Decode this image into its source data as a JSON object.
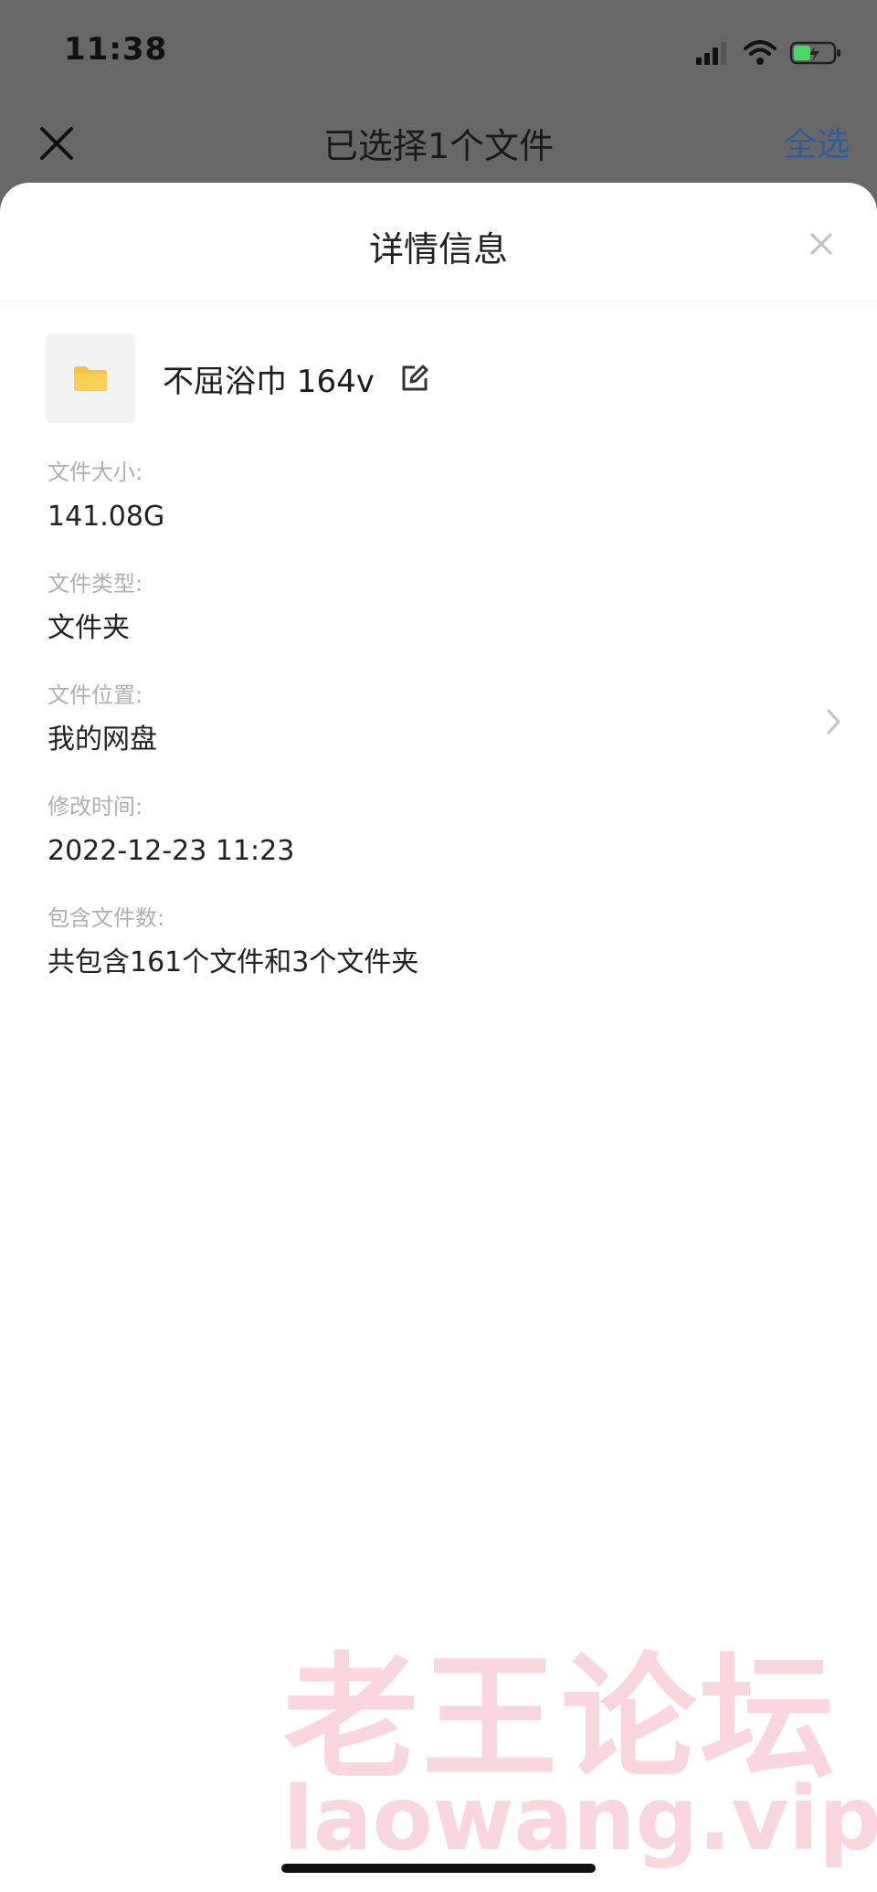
{
  "status_bar": {
    "time": "11:38",
    "icons": [
      "signal-icon",
      "wifi-icon",
      "battery-icon"
    ]
  },
  "nav": {
    "close_icon": "close-icon",
    "title": "已选择1个文件",
    "select_all": "全选"
  },
  "sheet": {
    "title": "详情信息",
    "close_icon": "close-icon"
  },
  "file": {
    "icon": "folder-icon",
    "name": "不屈浴巾 164v",
    "edit_icon": "edit-icon"
  },
  "details": [
    {
      "label": "文件大小:",
      "value": "141.08G"
    },
    {
      "label": "文件类型:",
      "value": "文件夹"
    },
    {
      "label": "文件位置:",
      "value": "我的网盘"
    },
    {
      "label": "修改时间:",
      "value": "2022-12-23 11:23"
    },
    {
      "label": "包含文件数:",
      "value": "共包含161个文件和3个文件夹"
    }
  ],
  "watermark": {
    "cn": "老王论坛",
    "en": "laowang.vip"
  },
  "colors": {
    "dim_overlay": "#686868",
    "accent_blue": "#2f5d9a",
    "folder_yellow": "#f6c444",
    "battery_green": "#4cd964",
    "watermark_pink": "#e86e82"
  }
}
